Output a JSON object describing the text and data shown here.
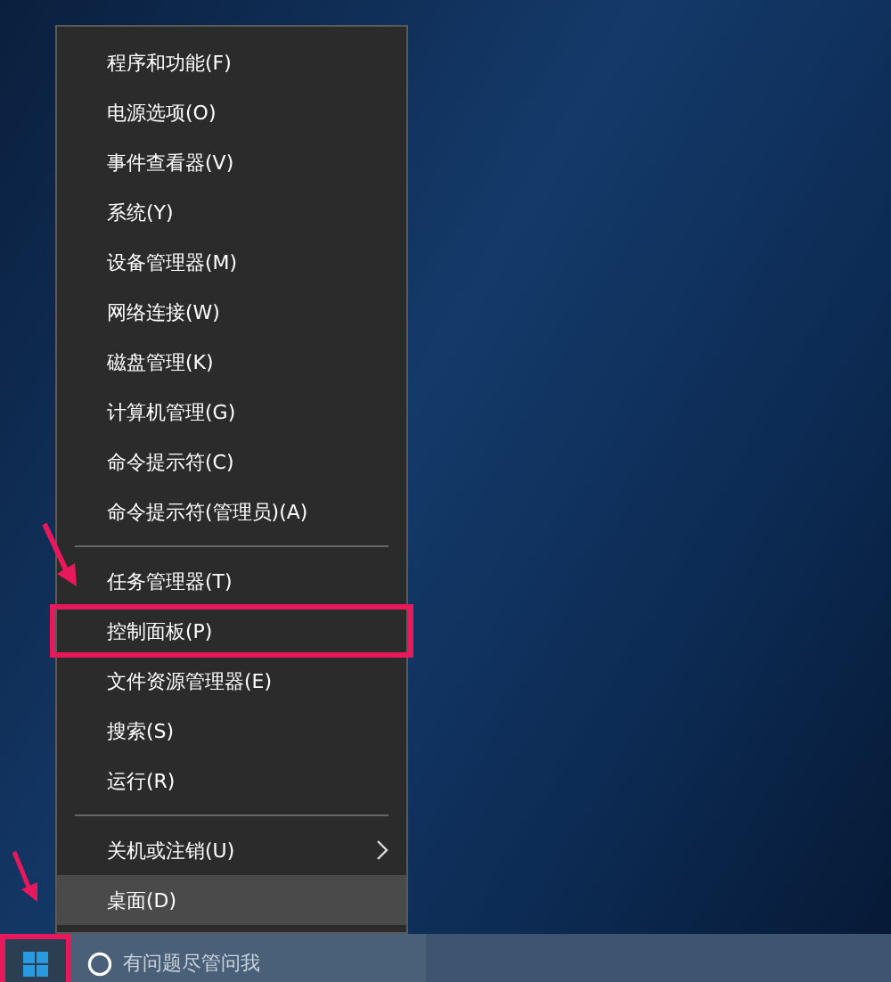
{
  "menu": {
    "groups": [
      {
        "items": [
          {
            "label": "程序和功能(F)",
            "selected": false,
            "annotated": false,
            "submenu": false
          },
          {
            "label": "电源选项(O)",
            "selected": false,
            "annotated": false,
            "submenu": false
          },
          {
            "label": "事件查看器(V)",
            "selected": false,
            "annotated": false,
            "submenu": false
          },
          {
            "label": "系统(Y)",
            "selected": false,
            "annotated": false,
            "submenu": false
          },
          {
            "label": "设备管理器(M)",
            "selected": false,
            "annotated": false,
            "submenu": false
          },
          {
            "label": "网络连接(W)",
            "selected": false,
            "annotated": false,
            "submenu": false
          },
          {
            "label": "磁盘管理(K)",
            "selected": false,
            "annotated": false,
            "submenu": false
          },
          {
            "label": "计算机管理(G)",
            "selected": false,
            "annotated": false,
            "submenu": false
          },
          {
            "label": "命令提示符(C)",
            "selected": false,
            "annotated": false,
            "submenu": false
          },
          {
            "label": "命令提示符(管理员)(A)",
            "selected": false,
            "annotated": false,
            "submenu": false
          }
        ]
      },
      {
        "items": [
          {
            "label": "任务管理器(T)",
            "selected": false,
            "annotated": false,
            "submenu": false
          },
          {
            "label": "控制面板(P)",
            "selected": false,
            "annotated": true,
            "submenu": false
          },
          {
            "label": "文件资源管理器(E)",
            "selected": false,
            "annotated": false,
            "submenu": false
          },
          {
            "label": "搜索(S)",
            "selected": false,
            "annotated": false,
            "submenu": false
          },
          {
            "label": "运行(R)",
            "selected": false,
            "annotated": false,
            "submenu": false
          }
        ]
      },
      {
        "items": [
          {
            "label": "关机或注销(U)",
            "selected": false,
            "annotated": false,
            "submenu": true
          },
          {
            "label": "桌面(D)",
            "selected": true,
            "annotated": false,
            "submenu": false
          }
        ]
      }
    ]
  },
  "taskbar": {
    "start_button": {
      "annotated": true
    },
    "search": {
      "placeholder": "有问题尽管问我"
    }
  }
}
